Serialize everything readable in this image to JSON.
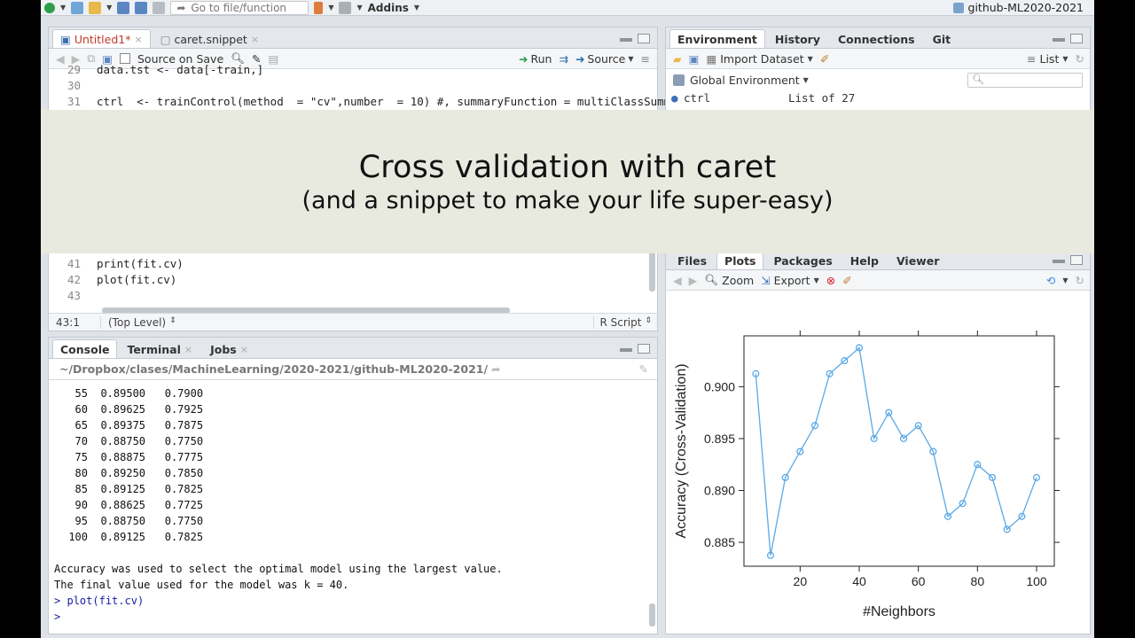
{
  "toolbar": {
    "goto_placeholder": "Go to file/function",
    "addins_label": "Addins",
    "project_label": "github-ML2020-2021"
  },
  "source_pane": {
    "tabs": [
      {
        "label": "Untitled1*",
        "modified": true
      },
      {
        "label": "caret.snippet"
      }
    ],
    "source_on_save_label": "Source on Save",
    "run_label": "Run",
    "source_label": "Source",
    "code_top": [
      {
        "num": "29",
        "text": "data.tst <- data[-train,]"
      },
      {
        "num": "30",
        "text": ""
      },
      {
        "num": "31",
        "text": "ctrl  <- trainControl(method  = \"cv\",number  = 10) #, summaryFunction = multiClassSumm"
      }
    ],
    "code_bottom": [
      {
        "num": "41",
        "text": "print(fit.cv)"
      },
      {
        "num": "42",
        "text": "plot(fit.cv)"
      },
      {
        "num": "43",
        "text": ""
      }
    ],
    "status": {
      "position": "43:1",
      "scope": "(Top Level)",
      "filetype": "R Script"
    }
  },
  "console_pane": {
    "tabs": [
      {
        "label": "Console"
      },
      {
        "label": "Terminal"
      },
      {
        "label": "Jobs"
      }
    ],
    "path": "~/Dropbox/clases/MachineLearning/2020-2021/github-ML2020-2021/",
    "table_rows": [
      {
        "k": "55",
        "acc": "0.89500",
        "kappa": "0.7900"
      },
      {
        "k": "60",
        "acc": "0.89625",
        "kappa": "0.7925"
      },
      {
        "k": "65",
        "acc": "0.89375",
        "kappa": "0.7875"
      },
      {
        "k": "70",
        "acc": "0.88750",
        "kappa": "0.7750"
      },
      {
        "k": "75",
        "acc": "0.88875",
        "kappa": "0.7775"
      },
      {
        "k": "80",
        "acc": "0.89250",
        "kappa": "0.7850"
      },
      {
        "k": "85",
        "acc": "0.89125",
        "kappa": "0.7825"
      },
      {
        "k": "90",
        "acc": "0.88625",
        "kappa": "0.7725"
      },
      {
        "k": "95",
        "acc": "0.88750",
        "kappa": "0.7750"
      },
      {
        "k": "100",
        "acc": "0.89125",
        "kappa": "0.7825"
      }
    ],
    "message_1": "Accuracy was used to select the optimal model using the largest value.",
    "message_2": "The final value used for the model was k = 40.",
    "command": "plot(fit.cv)",
    "prompt_symbol": ">"
  },
  "env_pane": {
    "tabs": [
      {
        "label": "Environment"
      },
      {
        "label": "History"
      },
      {
        "label": "Connections"
      },
      {
        "label": "Git"
      }
    ],
    "import_label": "Import Dataset",
    "list_label": "List",
    "global_env_label": "Global Environment",
    "var_name": "ctrl",
    "var_value": "List of 27"
  },
  "banner": {
    "title": "Cross validation with caret",
    "subtitle": "(and a snippet to make your life super-easy)"
  },
  "plots_pane": {
    "tabs": [
      {
        "label": "Files"
      },
      {
        "label": "Plots"
      },
      {
        "label": "Packages"
      },
      {
        "label": "Help"
      },
      {
        "label": "Viewer"
      }
    ],
    "zoom_label": "Zoom",
    "export_label": "Export"
  },
  "chart_data": {
    "type": "line",
    "title": "",
    "xlabel": "#Neighbors",
    "ylabel": "Accuracy (Cross-Validation)",
    "x": [
      5,
      10,
      15,
      20,
      25,
      30,
      35,
      40,
      45,
      50,
      55,
      60,
      65,
      70,
      75,
      80,
      85,
      90,
      95,
      100
    ],
    "series": [
      {
        "values": [
          0.90125,
          0.88375,
          0.89125,
          0.89375,
          0.89625,
          0.90125,
          0.9025,
          0.90375,
          0.895,
          0.8975,
          0.895,
          0.89625,
          0.89375,
          0.8875,
          0.88875,
          0.8925,
          0.89125,
          0.88625,
          0.8875,
          0.89125
        ],
        "color": "#5aa9e6"
      }
    ],
    "xticks": [
      "20",
      "40",
      "60",
      "80",
      "100"
    ],
    "xtick_values": [
      20,
      40,
      60,
      80,
      100
    ],
    "yticks": [
      "0.885",
      "0.890",
      "0.895",
      "0.900"
    ],
    "ytick_values": [
      0.885,
      0.89,
      0.895,
      0.9
    ],
    "xlim": [
      1,
      106
    ],
    "ylim": [
      0.8827,
      0.9049
    ],
    "grid": false
  }
}
